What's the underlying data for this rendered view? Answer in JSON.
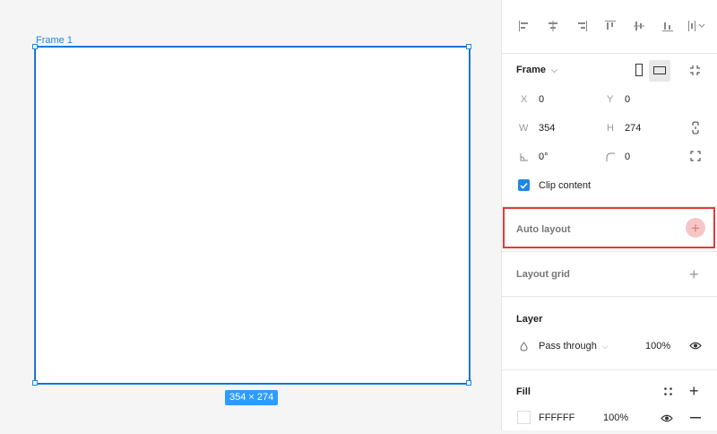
{
  "canvas": {
    "frame_label": "Frame 1",
    "dimensions": "354 × 274"
  },
  "panel": {
    "align_icons": [
      "align-left-icon",
      "align-center-h-icon",
      "align-right-icon",
      "align-top-icon",
      "align-middle-v-icon",
      "align-bottom-icon",
      "distribute-icon"
    ],
    "frame": {
      "title": "Frame",
      "x_label": "X",
      "x_value": "0",
      "y_label": "Y",
      "y_value": "0",
      "w_label": "W",
      "w_value": "354",
      "h_label": "H",
      "h_value": "274",
      "rotation_value": "0°",
      "radius_value": "0",
      "clip_content_label": "Clip content",
      "clip_content_checked": true
    },
    "auto_layout": {
      "title": "Auto layout"
    },
    "layout_grid": {
      "title": "Layout grid"
    },
    "layer": {
      "title": "Layer",
      "blend_mode": "Pass through",
      "opacity": "100%"
    },
    "fill": {
      "title": "Fill",
      "hex": "FFFFFF",
      "opacity": "100%",
      "swatch_color": "#FFFFFF"
    }
  },
  "colors": {
    "accent": "#1e88e5",
    "highlight": "#e53935"
  }
}
